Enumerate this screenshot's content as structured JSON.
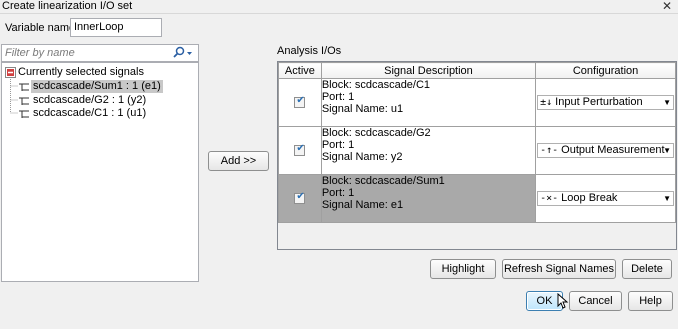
{
  "window": {
    "title": "Create linearization I/O set",
    "close_glyph": "✕"
  },
  "variable": {
    "label": "Variable name:",
    "value": "InnerLoop"
  },
  "filter": {
    "placeholder": "Filter by name"
  },
  "tree": {
    "root": "Currently selected signals",
    "items": [
      {
        "label": "scdcascade/Sum1 : 1 (e1)"
      },
      {
        "label": "scdcascade/G2 : 1 (y2)"
      },
      {
        "label": "scdcascade/C1 : 1 (u1)"
      }
    ]
  },
  "add_button": "Add >>",
  "analysis": {
    "heading": "Analysis I/Os",
    "columns": [
      "Active",
      "Signal Description",
      "Configuration"
    ],
    "rows": [
      {
        "block": "Block: scdcascade/C1",
        "port": "Port: 1",
        "signal": "Signal Name: u1",
        "config": "Input Perturbation",
        "icon": "±↓"
      },
      {
        "block": "Block: scdcascade/G2",
        "port": "Port: 1",
        "signal": "Signal Name: y2",
        "config": "Output Measurement",
        "icon": "-↑-"
      },
      {
        "block": "Block: scdcascade/Sum1",
        "port": "Port: 1",
        "signal": "Signal Name: e1",
        "config": "Loop Break",
        "icon": "-×-"
      }
    ]
  },
  "buttons": {
    "highlight": "Highlight",
    "refresh": "Refresh Signal Names",
    "delete": "Delete",
    "ok": "OK",
    "cancel": "Cancel",
    "help": "Help"
  }
}
